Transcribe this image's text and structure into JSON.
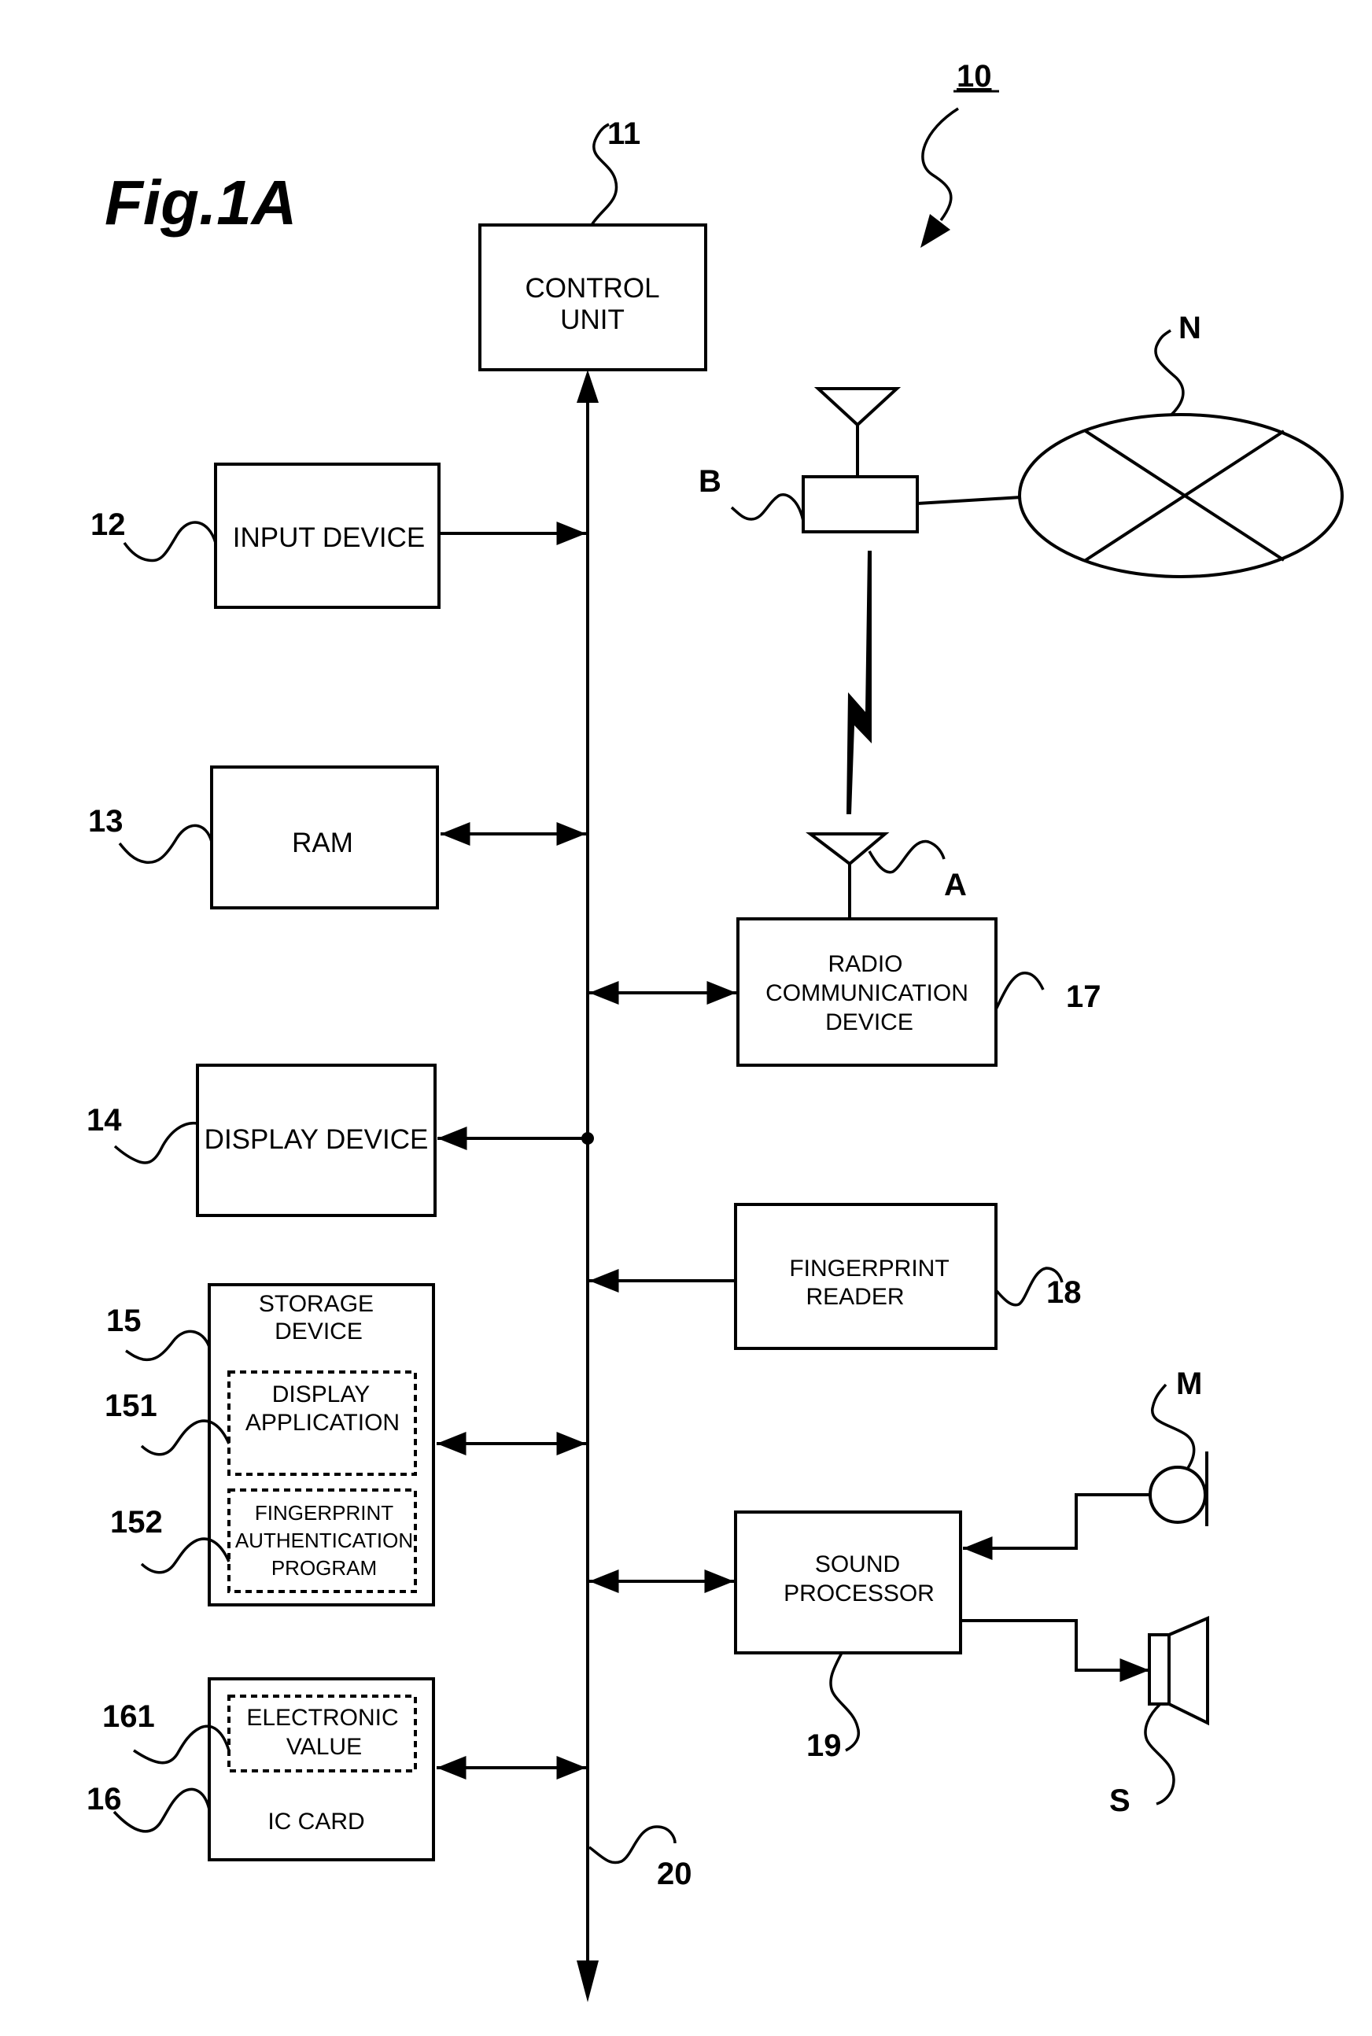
{
  "figure_label": "Fig.1A",
  "system_ref": "10",
  "bus_ref": "20",
  "blocks": {
    "control_unit": {
      "ref": "11",
      "lines": [
        "CONTROL",
        "UNIT"
      ]
    },
    "input_device": {
      "ref": "12",
      "lines": [
        "INPUT DEVICE"
      ]
    },
    "ram": {
      "ref": "13",
      "lines": [
        "RAM"
      ]
    },
    "display_device": {
      "ref": "14",
      "lines": [
        "DISPLAY DEVICE"
      ]
    },
    "storage_device": {
      "ref": "15",
      "lines": [
        "STORAGE",
        "DEVICE"
      ]
    },
    "display_application": {
      "ref": "151",
      "lines": [
        "DISPLAY",
        "APPLICATION"
      ]
    },
    "fingerprint_auth_program": {
      "ref": "152",
      "lines": [
        "FINGERPRINT",
        "AUTHENTICATION",
        "PROGRAM"
      ]
    },
    "ic_card": {
      "ref": "16",
      "lines": [
        "IC CARD"
      ]
    },
    "electronic_value": {
      "ref": "161",
      "lines": [
        "ELECTRONIC",
        "VALUE"
      ]
    },
    "radio_communication_device": {
      "ref": "17",
      "lines": [
        "RADIO",
        "COMMUNICATION",
        "DEVICE"
      ]
    },
    "fingerprint_reader": {
      "ref": "18",
      "lines": [
        "FINGERPRINT",
        "READER"
      ]
    },
    "sound_processor": {
      "ref": "19",
      "lines": [
        "SOUND",
        "PROCESSOR"
      ]
    }
  },
  "external": {
    "antenna_a": "A",
    "base_station_b": "B",
    "network_n": "N",
    "microphone_m": "M",
    "speaker_s": "S"
  }
}
